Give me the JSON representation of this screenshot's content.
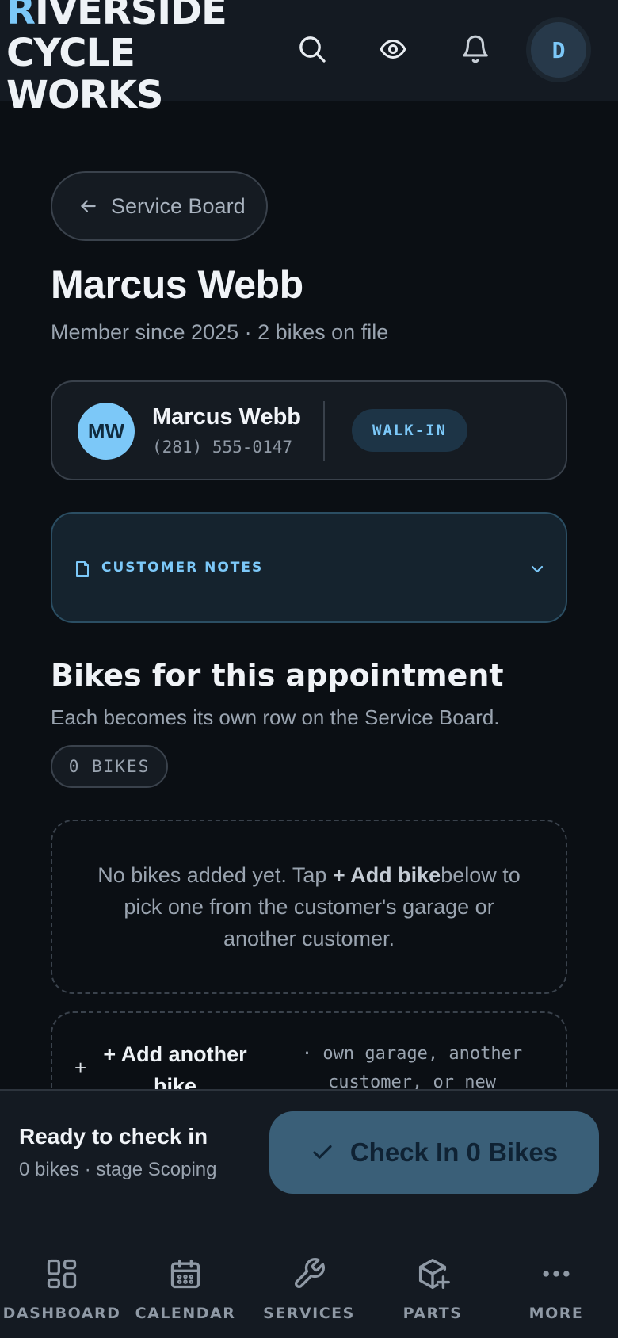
{
  "header": {
    "brand_line1_first": "R",
    "brand_line1_rest": "IVERSIDE",
    "brand_line2": "CYCLE",
    "brand_line3": "WORKS",
    "user_initial": "D",
    "icons": [
      "search-icon",
      "eye-icon",
      "bell-icon"
    ]
  },
  "back": {
    "label": "Service Board"
  },
  "page": {
    "title": "Marcus Webb",
    "subtitle": "Member since 2025 · 2 bikes on file"
  },
  "customer": {
    "initials": "MW",
    "name": "Marcus Webb",
    "phone": "(281) 555-0147",
    "badge": "WALK-IN"
  },
  "notes": {
    "label": "CUSTOMER NOTES"
  },
  "bikes_section": {
    "title": "Bikes for this appointment",
    "subtitle": "Each becomes its own row on the Service Board.",
    "count": "0 BIKES",
    "empty_pre": "No bikes added yet. Tap ",
    "empty_bold": "+ Add bike",
    "empty_post": "below to pick one from the customer's garage or another customer.",
    "add_plus": "+",
    "add_label": "+ Add another bike",
    "add_hint": "· own garage, another customer, or new"
  },
  "checkin": {
    "title": "Ready to check in",
    "subtitle": "0 bikes · stage Scoping",
    "button": "Check In 0 Bikes"
  },
  "nav": {
    "items": [
      {
        "label": "DASHBOARD",
        "icon": "dashboard-icon"
      },
      {
        "label": "CALENDAR",
        "icon": "calendar-icon"
      },
      {
        "label": "SERVICES",
        "icon": "wrench-icon"
      },
      {
        "label": "PARTS",
        "icon": "parts-box-icon"
      },
      {
        "label": "MORE",
        "icon": "more-dots-icon"
      }
    ]
  },
  "colors": {
    "accent": "#7cc8f8",
    "background": "#0b0f14",
    "surface": "#151b22",
    "checkin_button": "#3a5f78"
  }
}
